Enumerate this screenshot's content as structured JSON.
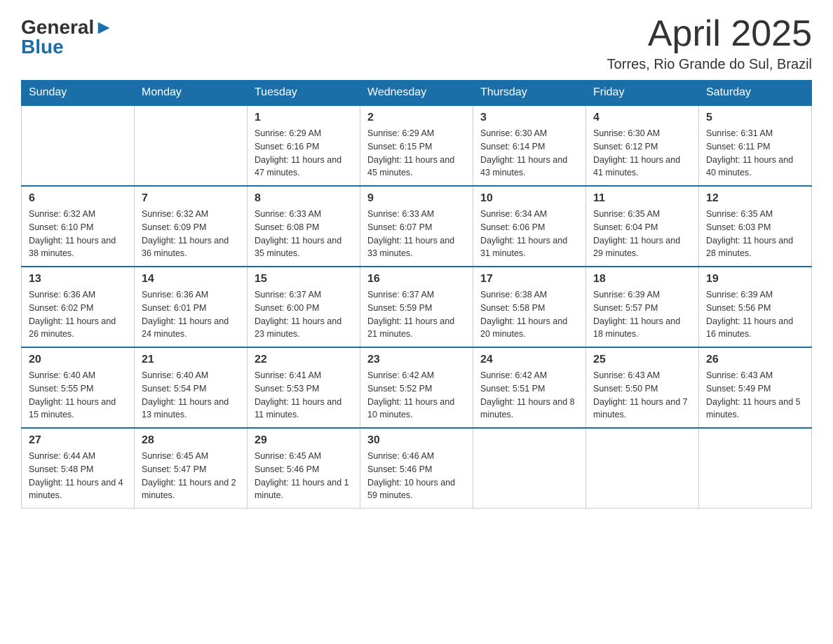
{
  "logo": {
    "general": "General",
    "blue": "Blue"
  },
  "title": "April 2025",
  "location": "Torres, Rio Grande do Sul, Brazil",
  "weekdays": [
    "Sunday",
    "Monday",
    "Tuesday",
    "Wednesday",
    "Thursday",
    "Friday",
    "Saturday"
  ],
  "weeks": [
    [
      {
        "day": "",
        "sunrise": "",
        "sunset": "",
        "daylight": ""
      },
      {
        "day": "",
        "sunrise": "",
        "sunset": "",
        "daylight": ""
      },
      {
        "day": "1",
        "sunrise": "Sunrise: 6:29 AM",
        "sunset": "Sunset: 6:16 PM",
        "daylight": "Daylight: 11 hours and 47 minutes."
      },
      {
        "day": "2",
        "sunrise": "Sunrise: 6:29 AM",
        "sunset": "Sunset: 6:15 PM",
        "daylight": "Daylight: 11 hours and 45 minutes."
      },
      {
        "day": "3",
        "sunrise": "Sunrise: 6:30 AM",
        "sunset": "Sunset: 6:14 PM",
        "daylight": "Daylight: 11 hours and 43 minutes."
      },
      {
        "day": "4",
        "sunrise": "Sunrise: 6:30 AM",
        "sunset": "Sunset: 6:12 PM",
        "daylight": "Daylight: 11 hours and 41 minutes."
      },
      {
        "day": "5",
        "sunrise": "Sunrise: 6:31 AM",
        "sunset": "Sunset: 6:11 PM",
        "daylight": "Daylight: 11 hours and 40 minutes."
      }
    ],
    [
      {
        "day": "6",
        "sunrise": "Sunrise: 6:32 AM",
        "sunset": "Sunset: 6:10 PM",
        "daylight": "Daylight: 11 hours and 38 minutes."
      },
      {
        "day": "7",
        "sunrise": "Sunrise: 6:32 AM",
        "sunset": "Sunset: 6:09 PM",
        "daylight": "Daylight: 11 hours and 36 minutes."
      },
      {
        "day": "8",
        "sunrise": "Sunrise: 6:33 AM",
        "sunset": "Sunset: 6:08 PM",
        "daylight": "Daylight: 11 hours and 35 minutes."
      },
      {
        "day": "9",
        "sunrise": "Sunrise: 6:33 AM",
        "sunset": "Sunset: 6:07 PM",
        "daylight": "Daylight: 11 hours and 33 minutes."
      },
      {
        "day": "10",
        "sunrise": "Sunrise: 6:34 AM",
        "sunset": "Sunset: 6:06 PM",
        "daylight": "Daylight: 11 hours and 31 minutes."
      },
      {
        "day": "11",
        "sunrise": "Sunrise: 6:35 AM",
        "sunset": "Sunset: 6:04 PM",
        "daylight": "Daylight: 11 hours and 29 minutes."
      },
      {
        "day": "12",
        "sunrise": "Sunrise: 6:35 AM",
        "sunset": "Sunset: 6:03 PM",
        "daylight": "Daylight: 11 hours and 28 minutes."
      }
    ],
    [
      {
        "day": "13",
        "sunrise": "Sunrise: 6:36 AM",
        "sunset": "Sunset: 6:02 PM",
        "daylight": "Daylight: 11 hours and 26 minutes."
      },
      {
        "day": "14",
        "sunrise": "Sunrise: 6:36 AM",
        "sunset": "Sunset: 6:01 PM",
        "daylight": "Daylight: 11 hours and 24 minutes."
      },
      {
        "day": "15",
        "sunrise": "Sunrise: 6:37 AM",
        "sunset": "Sunset: 6:00 PM",
        "daylight": "Daylight: 11 hours and 23 minutes."
      },
      {
        "day": "16",
        "sunrise": "Sunrise: 6:37 AM",
        "sunset": "Sunset: 5:59 PM",
        "daylight": "Daylight: 11 hours and 21 minutes."
      },
      {
        "day": "17",
        "sunrise": "Sunrise: 6:38 AM",
        "sunset": "Sunset: 5:58 PM",
        "daylight": "Daylight: 11 hours and 20 minutes."
      },
      {
        "day": "18",
        "sunrise": "Sunrise: 6:39 AM",
        "sunset": "Sunset: 5:57 PM",
        "daylight": "Daylight: 11 hours and 18 minutes."
      },
      {
        "day": "19",
        "sunrise": "Sunrise: 6:39 AM",
        "sunset": "Sunset: 5:56 PM",
        "daylight": "Daylight: 11 hours and 16 minutes."
      }
    ],
    [
      {
        "day": "20",
        "sunrise": "Sunrise: 6:40 AM",
        "sunset": "Sunset: 5:55 PM",
        "daylight": "Daylight: 11 hours and 15 minutes."
      },
      {
        "day": "21",
        "sunrise": "Sunrise: 6:40 AM",
        "sunset": "Sunset: 5:54 PM",
        "daylight": "Daylight: 11 hours and 13 minutes."
      },
      {
        "day": "22",
        "sunrise": "Sunrise: 6:41 AM",
        "sunset": "Sunset: 5:53 PM",
        "daylight": "Daylight: 11 hours and 11 minutes."
      },
      {
        "day": "23",
        "sunrise": "Sunrise: 6:42 AM",
        "sunset": "Sunset: 5:52 PM",
        "daylight": "Daylight: 11 hours and 10 minutes."
      },
      {
        "day": "24",
        "sunrise": "Sunrise: 6:42 AM",
        "sunset": "Sunset: 5:51 PM",
        "daylight": "Daylight: 11 hours and 8 minutes."
      },
      {
        "day": "25",
        "sunrise": "Sunrise: 6:43 AM",
        "sunset": "Sunset: 5:50 PM",
        "daylight": "Daylight: 11 hours and 7 minutes."
      },
      {
        "day": "26",
        "sunrise": "Sunrise: 6:43 AM",
        "sunset": "Sunset: 5:49 PM",
        "daylight": "Daylight: 11 hours and 5 minutes."
      }
    ],
    [
      {
        "day": "27",
        "sunrise": "Sunrise: 6:44 AM",
        "sunset": "Sunset: 5:48 PM",
        "daylight": "Daylight: 11 hours and 4 minutes."
      },
      {
        "day": "28",
        "sunrise": "Sunrise: 6:45 AM",
        "sunset": "Sunset: 5:47 PM",
        "daylight": "Daylight: 11 hours and 2 minutes."
      },
      {
        "day": "29",
        "sunrise": "Sunrise: 6:45 AM",
        "sunset": "Sunset: 5:46 PM",
        "daylight": "Daylight: 11 hours and 1 minute."
      },
      {
        "day": "30",
        "sunrise": "Sunrise: 6:46 AM",
        "sunset": "Sunset: 5:46 PM",
        "daylight": "Daylight: 10 hours and 59 minutes."
      },
      {
        "day": "",
        "sunrise": "",
        "sunset": "",
        "daylight": ""
      },
      {
        "day": "",
        "sunrise": "",
        "sunset": "",
        "daylight": ""
      },
      {
        "day": "",
        "sunrise": "",
        "sunset": "",
        "daylight": ""
      }
    ]
  ]
}
